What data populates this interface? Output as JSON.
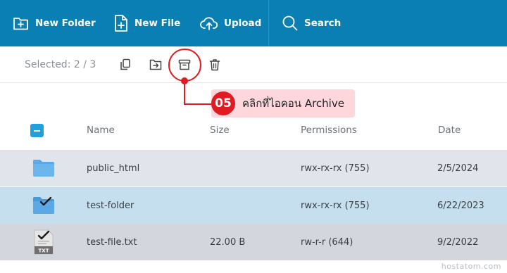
{
  "toolbar": {
    "new_folder": "New Folder",
    "new_file": "New File",
    "upload": "Upload",
    "search": "Search"
  },
  "actionbar": {
    "selected": "Selected: 2 / 3",
    "icons": [
      "copy-icon",
      "move-icon",
      "archive-icon",
      "trash-icon"
    ]
  },
  "callout": {
    "number": "05",
    "text": "คลิกที่ไอคอน Archive"
  },
  "table": {
    "headers": {
      "name": "Name",
      "size": "Size",
      "permissions": "Permissions",
      "date": "Date"
    },
    "rows": [
      {
        "name": "public_html",
        "size": "",
        "permissions": "rwx-rx-rx (755)",
        "date": "2/5/2024",
        "type": "folder",
        "selected": false
      },
      {
        "name": "test-folder",
        "size": "",
        "permissions": "rwx-rx-rx (755)",
        "date": "6/22/2023",
        "type": "folder",
        "selected": true
      },
      {
        "name": "test-file.txt",
        "size": "22.00 B",
        "permissions": "rw-r-r (644)",
        "date": "9/2/2022",
        "type": "txt",
        "selected": true
      }
    ]
  },
  "watermark": "hostatom.com",
  "colors": {
    "toolbar_bg": "#0a7fb4",
    "accent": "#21a0dc",
    "highlight": "#e01b22"
  }
}
